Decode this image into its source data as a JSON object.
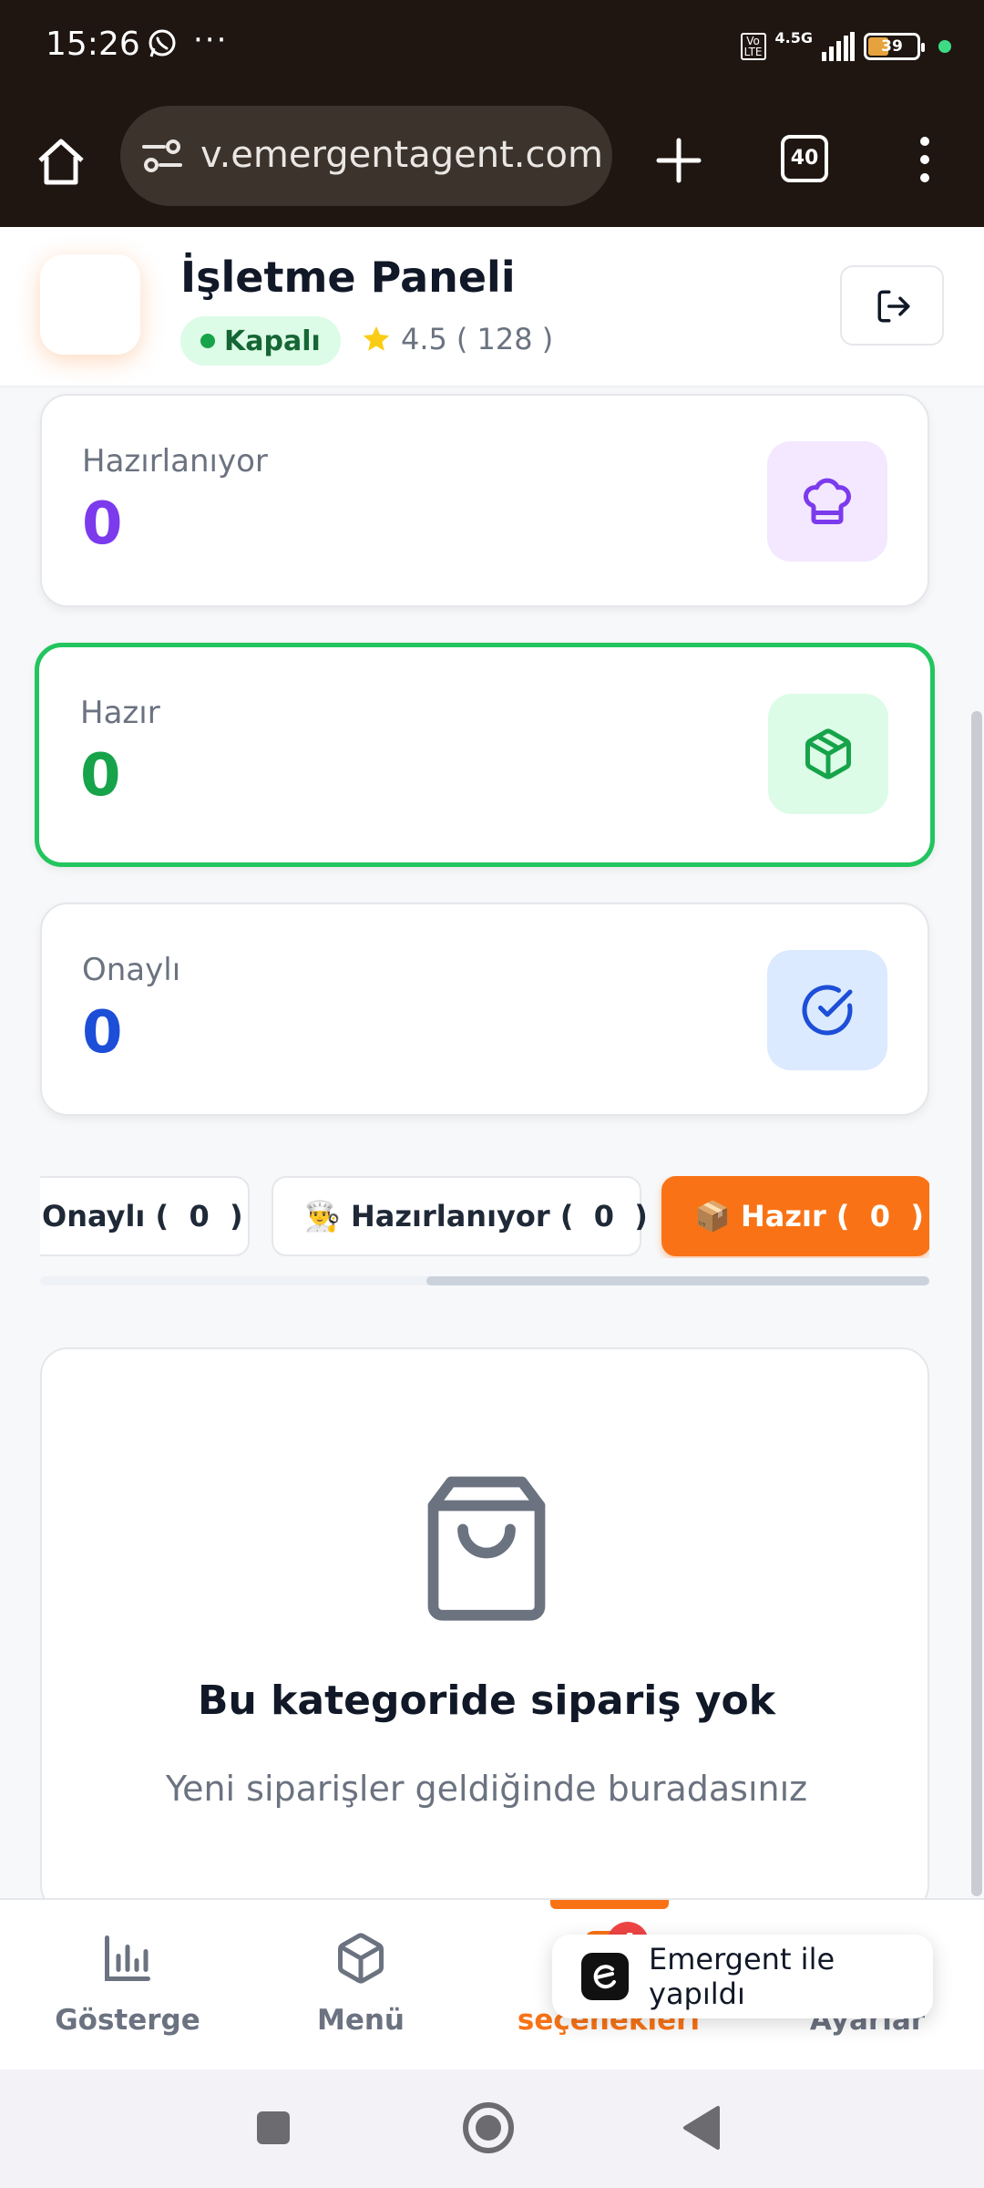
{
  "status_bar": {
    "time": "15:26",
    "more_indicator": "···",
    "network": "4.5G",
    "volte": "Vo\nLTE",
    "battery": "39",
    "icons": [
      "whatsapp-icon",
      "signal-icon",
      "battery-icon"
    ]
  },
  "browser": {
    "url": "v.emergentagent.com",
    "tab_count": "40",
    "icons": [
      "home-icon",
      "site-settings-icon",
      "new-tab-icon",
      "menu-icon"
    ]
  },
  "header": {
    "title": "İşletme Paneli",
    "status": "Kapalı",
    "rating": "4.5",
    "rating_count": "( 128 )",
    "icons": [
      "star-icon",
      "logout-icon"
    ]
  },
  "stats": [
    {
      "label": "Hazırlanıyor",
      "value": "0",
      "color": "#7c3aed",
      "bg": "#f3e8ff",
      "icon": "chef-hat-icon"
    },
    {
      "label": "Hazır",
      "value": "0",
      "color": "#16a34a",
      "bg": "#dcfce7",
      "icon": "package-icon"
    },
    {
      "label": "Onaylı",
      "value": "0",
      "color": "#1d4ed8",
      "bg": "#dbeafe",
      "icon": "check-circle-icon"
    }
  ],
  "tabs": [
    {
      "label": "Onaylı (  0  )"
    },
    {
      "label": "👨‍🍳 Hazırlanıyor (  0  )"
    },
    {
      "label": "📦 Hazır (  0  )",
      "active": true
    }
  ],
  "empty_state": {
    "title": "Bu kategoride sipariş yok",
    "subtitle": "Yeni siparişler geldiğinde buradasınız",
    "icon": "shopping-bag-icon"
  },
  "bottom_nav": {
    "items": [
      {
        "label": "Gösterge",
        "icon": "bar-chart-icon"
      },
      {
        "label": "Menü",
        "icon": "box-icon"
      },
      {
        "label": "seçenekleri",
        "icon": "orders-icon",
        "active": true
      },
      {
        "label": "Ayarlar",
        "icon": "settings-icon"
      }
    ],
    "badge": "4"
  },
  "toast": {
    "text": "Emergent ile yapıldı"
  },
  "colors": {
    "accent": "#f97316",
    "success": "#22c55e"
  }
}
